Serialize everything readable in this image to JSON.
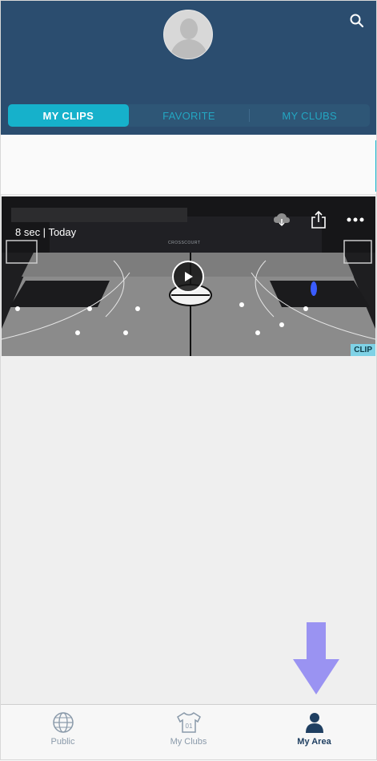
{
  "header": {
    "tabs": [
      {
        "label": "MY CLIPS",
        "active": true
      },
      {
        "label": "FAVORITE",
        "active": false
      },
      {
        "label": "MY CLUBS",
        "active": false
      }
    ],
    "colors": {
      "bar": "#2b4d6f",
      "accent": "#16b1cb"
    }
  },
  "clip": {
    "duration": "8 sec | Today",
    "badge": "CLIP",
    "court_brand": "CROSSCOURT",
    "icons": [
      "cloud-download-icon",
      "share-icon",
      "more-icon",
      "play-icon"
    ]
  },
  "bottom_nav": {
    "items": [
      {
        "label": "Public",
        "icon": "globe-icon",
        "active": false
      },
      {
        "label": "My Clubs",
        "icon": "jersey-icon",
        "jersey_number": "01",
        "active": false
      },
      {
        "label": "My Area",
        "icon": "person-icon",
        "active": true
      }
    ]
  },
  "annotation": {
    "arrow_color": "#9a93f2"
  }
}
